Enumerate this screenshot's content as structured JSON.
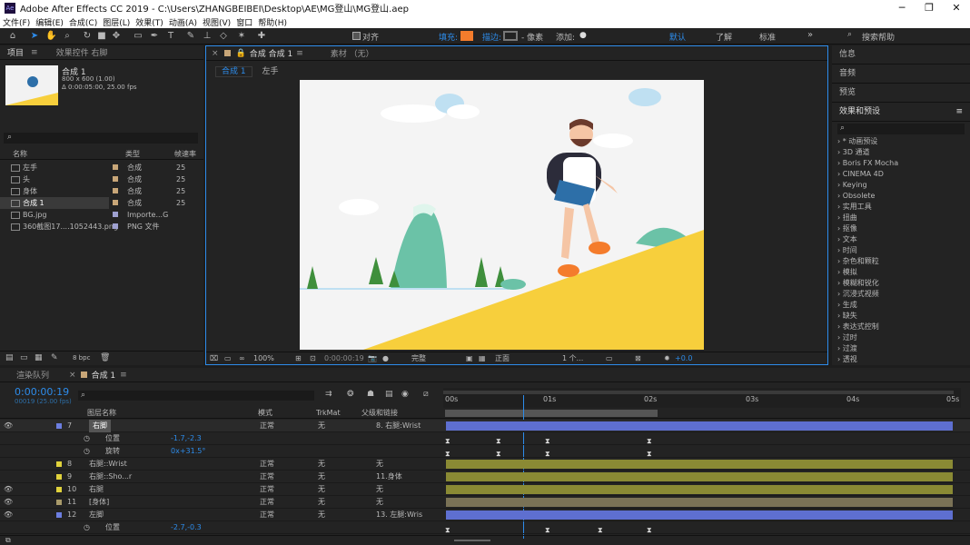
{
  "window": {
    "title": "Adobe After Effects CC 2019 - C:\\Users\\ZHANGBEIBEI\\Desktop\\AE\\MG登山\\MG登山.aep",
    "logo": "Ae"
  },
  "menu": [
    "文件(F)",
    "编辑(E)",
    "合成(C)",
    "图层(L)",
    "效果(T)",
    "动画(A)",
    "视图(V)",
    "窗口",
    "帮助(H)"
  ],
  "toolbar": {
    "align": "对齐",
    "fill": "填充:",
    "stroke": "描边:",
    "stroke_units": "- 像素",
    "add": "添加:",
    "workspaces": [
      "默认",
      "了解",
      "标准"
    ],
    "search": "搜索帮助",
    "fill_color": "#f47c2c"
  },
  "project": {
    "tab1": "项目",
    "tab2": "效果控件 右脚",
    "comp_name": "合成 1",
    "comp_size": "800 x 600 (1.00)",
    "comp_dur": "Δ 0:00:05:00, 25.00 fps",
    "col_name": "名称",
    "col_type": "类型",
    "col_fps": "帧速率",
    "items": [
      {
        "name": "左手",
        "type": "合成",
        "fps": "25"
      },
      {
        "name": "头",
        "type": "合成",
        "fps": "25"
      },
      {
        "name": "身体",
        "type": "合成",
        "fps": "25"
      },
      {
        "name": "合成 1",
        "type": "合成",
        "fps": "25"
      },
      {
        "name": "BG.jpg",
        "type": "Importe...G",
        "fps": ""
      },
      {
        "name": "360截图17....1052443.png",
        "type": "PNG 文件",
        "fps": ""
      }
    ],
    "bpc": "8 bpc"
  },
  "viewer": {
    "tab": "合成 合成 1",
    "tab2": "素材 （无）",
    "crumb1": "合成 1",
    "crumb2": "左手",
    "zoom": "100%",
    "time": "0:00:00:19",
    "quality": "完整",
    "view": "正面",
    "views": "1 个...",
    "exposure": "+0.0"
  },
  "right": {
    "items": [
      "信息",
      "音频",
      "预览",
      "效果和预设"
    ],
    "effects": [
      "* 动画预设",
      "3D 通道",
      "Boris FX Mocha",
      "CINEMA 4D",
      "Keying",
      "Obsolete",
      "实用工具",
      "扭曲",
      "抠像",
      "文本",
      "时间",
      "杂色和颗粒",
      "模拟",
      "模糊和锐化",
      "沉浸式视频",
      "生成",
      "缺失",
      "表达式控制",
      "过时",
      "过渡",
      "透视"
    ]
  },
  "timeline": {
    "tab1": "渲染队列",
    "tab2": "合成 1",
    "timecode": "0:00:00:19",
    "frames": "00019 (25.00 fps)",
    "cols": {
      "layer": "图层名称",
      "mode": "模式",
      "trk": "TrkMat",
      "parent": "父级和链接"
    },
    "ruler": [
      "00s",
      "01s",
      "02s",
      "03s",
      "04s",
      "05s"
    ],
    "layers": [
      {
        "num": "7",
        "name": "右脚",
        "mode": "正常",
        "trk": "无",
        "parent": "8. 右腿:Wrist",
        "color": "#6c7ee0"
      },
      {
        "prop": "位置",
        "val": "-1.7,-2.3"
      },
      {
        "prop": "旋转",
        "val": "0x+31.5°"
      },
      {
        "num": "8",
        "name": "右腿::Wrist",
        "mode": "正常",
        "trk": "无",
        "parent": "无",
        "color": "#e0d23c"
      },
      {
        "num": "9",
        "name": "右腿::Sho...r",
        "mode": "正常",
        "trk": "无",
        "parent": "11.身体",
        "color": "#e0d23c"
      },
      {
        "num": "10",
        "name": "右腿",
        "mode": "正常",
        "trk": "无",
        "parent": "无",
        "color": "#e0d23c"
      },
      {
        "num": "11",
        "name": "[身体]",
        "mode": "正常",
        "trk": "无",
        "parent": "无",
        "color": "#a89a6a"
      },
      {
        "num": "12",
        "name": "左脚",
        "mode": "正常",
        "trk": "无",
        "parent": "13. 左腿:Wris",
        "color": "#6c7ee0"
      },
      {
        "prop": "位置",
        "val": "-2.7,-0.3"
      }
    ]
  }
}
